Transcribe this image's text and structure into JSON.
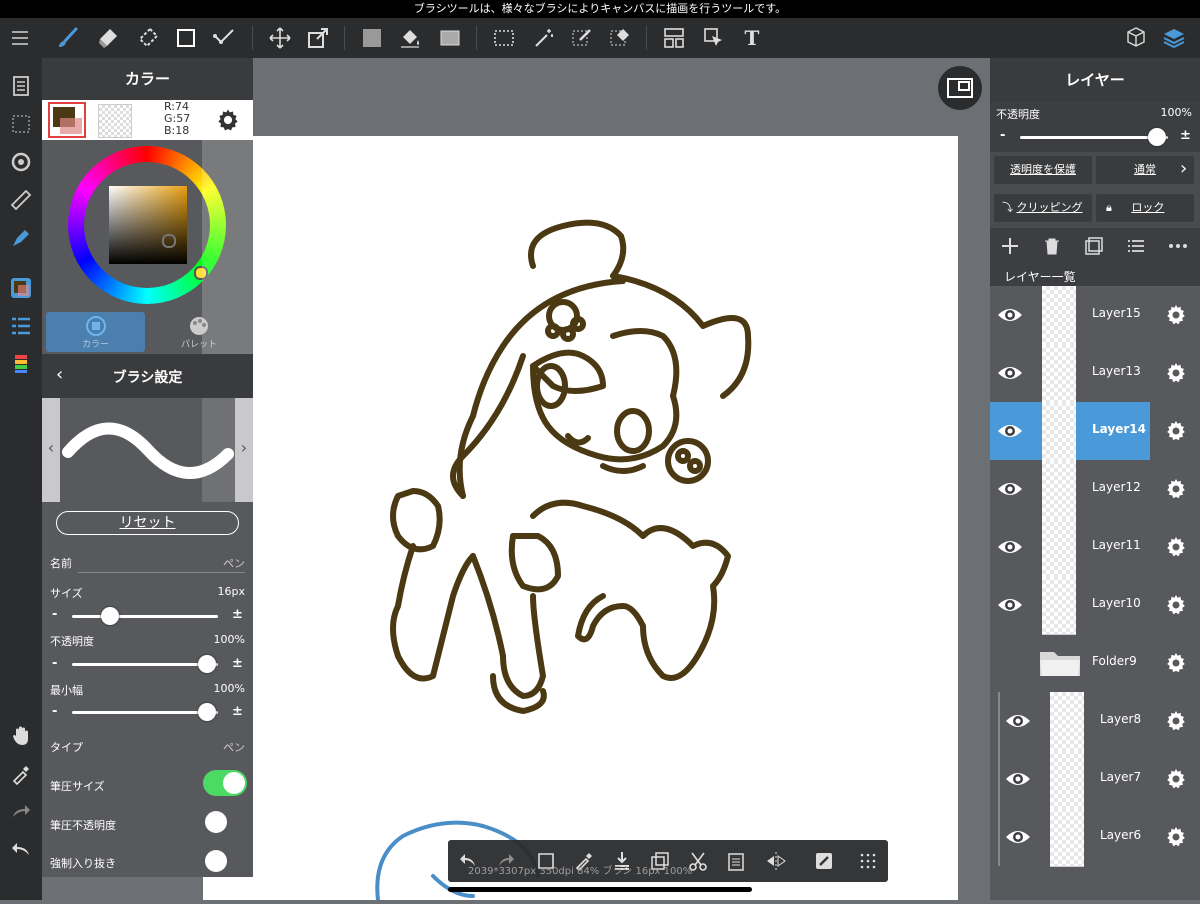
{
  "status_bar": {
    "text": "ブラシツールは、様々なブラシによりキャンバスに描画を行うツールです。"
  },
  "toolbar": {
    "tools": [
      "menu-icon",
      "brush-icon",
      "eraser-icon",
      "blur-eraser-icon",
      "rectangle-shape-icon",
      "line-tool-icon",
      "move-icon",
      "transform-icon",
      "fill-color-icon",
      "bucket-icon",
      "gradient-icon",
      "select-rect-icon",
      "magic-wand-icon",
      "select-pen-icon",
      "select-eraser-icon",
      "layout-icon",
      "select-move-icon",
      "text-icon",
      "3d-model-icon",
      "layers-icon"
    ]
  },
  "color_panel": {
    "title": "カラー",
    "rgb_r": "R:74",
    "rgb_g": "G:57",
    "rgb_b": "B:18",
    "main_color": "#4a3912",
    "tab_color": "カラー",
    "tab_palette": "パレット"
  },
  "brush_panel": {
    "title": "ブラシ設定",
    "reset": "リセット",
    "name_label": "名前",
    "name_value": "ペン",
    "size_label": "サイズ",
    "size_value": "16px",
    "size_fraction": 0.25,
    "opacity_label": "不透明度",
    "opacity_value": "100%",
    "opacity_fraction": 1.0,
    "minwidth_label": "最小幅",
    "minwidth_value": "100%",
    "minwidth_fraction": 1.0,
    "type_label": "タイプ",
    "type_value": "ペン",
    "pressure_size_label": "筆圧サイズ",
    "pressure_size_on": true,
    "pressure_opacity_label": "筆圧不透明度",
    "pressure_opacity_on": false,
    "force_fade_label": "強制入り抜き",
    "force_fade_on": false,
    "minus": "-",
    "plus": "±"
  },
  "layer_panel": {
    "title": "レイヤー",
    "opacity_label": "不透明度",
    "opacity_value": "100%",
    "opacity_fraction": 1.0,
    "protect_alpha": "透明度を保護",
    "blend_mode": "通常",
    "clipping": "クリッピング",
    "lock": "ロック",
    "list_title": "レイヤー一覧",
    "layers": [
      {
        "name": "Layer15",
        "selected": false,
        "folder": false
      },
      {
        "name": "Layer13",
        "selected": false,
        "folder": false
      },
      {
        "name": "Layer14",
        "selected": true,
        "folder": false
      },
      {
        "name": "Layer12",
        "selected": false,
        "folder": false
      },
      {
        "name": "Layer11",
        "selected": false,
        "folder": false
      },
      {
        "name": "Layer10",
        "selected": false,
        "folder": false
      },
      {
        "name": "Folder9",
        "selected": false,
        "folder": true
      },
      {
        "name": "Layer8",
        "selected": false,
        "folder": false
      },
      {
        "name": "Layer7",
        "selected": false,
        "folder": false
      },
      {
        "name": "Layer6",
        "selected": false,
        "folder": false
      }
    ]
  },
  "bottom_bar": {
    "info": "2039*3307px 350dpi 84% ブラシ 16px 100%"
  },
  "colors": {
    "accent_blue": "#4a9ad9",
    "toggle_on": "#4cd964",
    "line_color": "#4a3912",
    "selected_row": "#4a9ad9"
  }
}
